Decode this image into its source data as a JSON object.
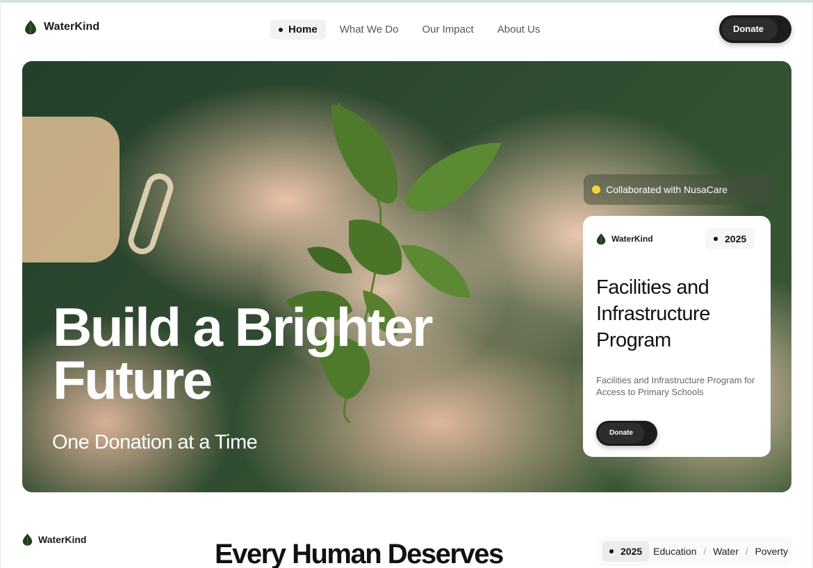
{
  "brand": {
    "name": "WaterKind",
    "icon": "leaf-drop-icon",
    "color": "#1f3d1f"
  },
  "nav": {
    "items": [
      {
        "label": "Home",
        "active": true
      },
      {
        "label": "What We Do",
        "active": false
      },
      {
        "label": "Our Impact",
        "active": false
      },
      {
        "label": "About Us",
        "active": false
      }
    ],
    "donate_label": "Donate"
  },
  "hero": {
    "title_line1": "Build a Brighter",
    "title_line2": "Future",
    "subtitle": "One Donation at a Time",
    "collab_label": "Collaborated with NusaCare",
    "card": {
      "brand_name": "WaterKind",
      "year": "2025",
      "title": "Facilities and Infrastructure Program",
      "description": "Facilities and Infrastructure Program for Access to Primary Schools",
      "donate_label": "Donate"
    }
  },
  "section": {
    "brand_name": "WaterKind",
    "title": "Every Human Deserves",
    "year": "2025",
    "tags": [
      "Education",
      "Water",
      "Poverty"
    ]
  },
  "colors": {
    "accent_dark": "#1c1c1c",
    "highlight_dot": "#f3d23c",
    "leaf_green": "#1f3d1f"
  }
}
